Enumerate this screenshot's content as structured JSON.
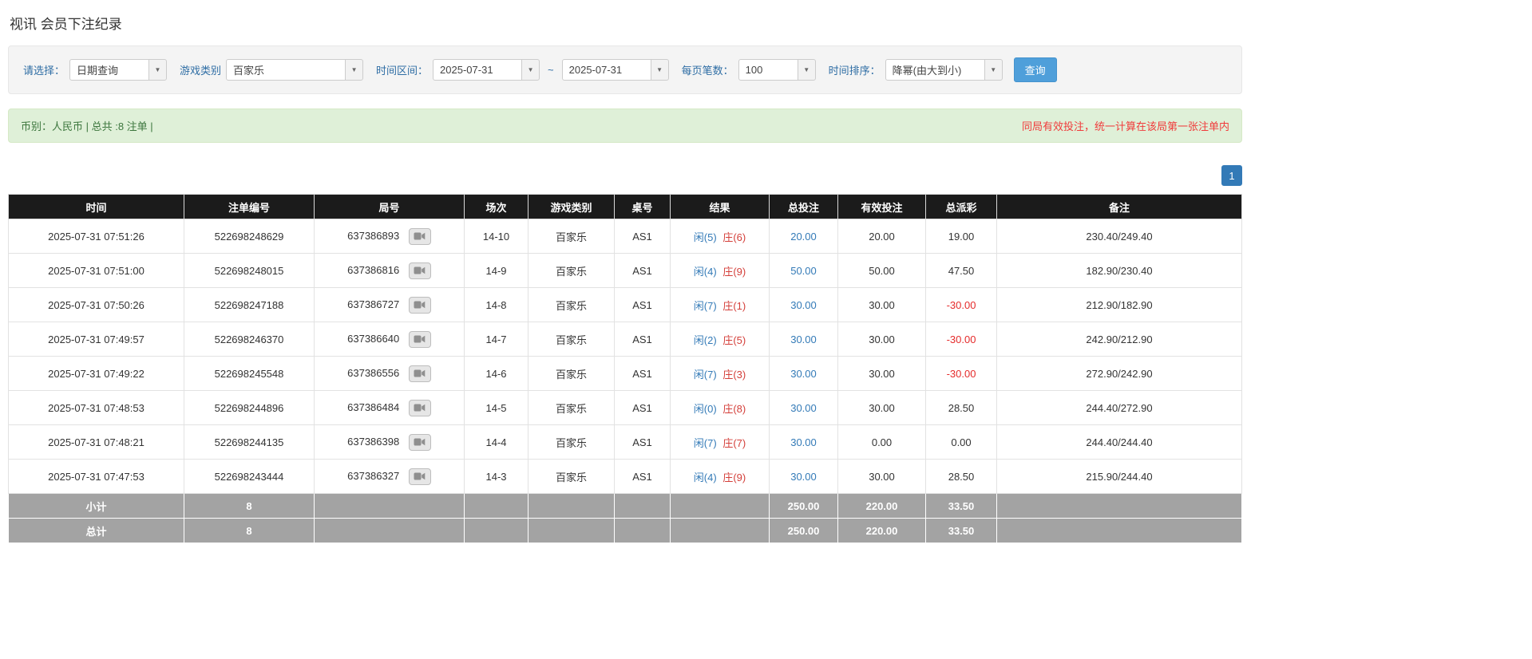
{
  "page": {
    "title": "视讯 会员下注纪录"
  },
  "filters": {
    "select_label": "请选择：",
    "select_value": "日期查询",
    "game_label": "游戏类别",
    "game_value": "百家乐",
    "range_label": "时间区间：",
    "date_from": "2025-07-31",
    "range_separator": "~",
    "date_to": "2025-07-31",
    "page_size_label": "每页笔数：",
    "page_size_value": "100",
    "sort_label": "时间排序：",
    "sort_value": "降幂(由大到小)",
    "search_button": "查询"
  },
  "summary": {
    "left": "币别：人民币 | 总共 :8 注单 |",
    "right": "同局有效投注，统一计算在该局第一张注单内"
  },
  "pagination": {
    "current": "1"
  },
  "icons": {
    "caret": "▼",
    "replay": "video-replay-icon"
  },
  "colors": {
    "header_bg": "#1b1b1b",
    "footer_bg": "#a3a3a3",
    "link_blue": "#337ab7",
    "banker_red": "#d43f3a",
    "negative_red": "#e52b2b",
    "summary_bg": "#dff0d8",
    "summary_text": "#3c763d",
    "notice_red": "#f03b3b",
    "search_button_bg": "#4f9fda",
    "pagination_bg": "#337ab7"
  },
  "table": {
    "headers": [
      "时间",
      "注单编号",
      "局号",
      "场次",
      "游戏类别",
      "桌号",
      "结果",
      "总投注",
      "有效投注",
      "总派彩",
      "备注"
    ],
    "rows": [
      {
        "time": "2025-07-31 07:51:26",
        "bet_id": "522698248629",
        "round_id": "637386893",
        "session": "14-10",
        "game_type": "百家乐",
        "table_no": "AS1",
        "result_player": "闲(5)",
        "result_banker": "庄(6)",
        "total_bet": "20.00",
        "valid_bet": "20.00",
        "payout": "19.00",
        "note": "230.40/249.40"
      },
      {
        "time": "2025-07-31 07:51:00",
        "bet_id": "522698248015",
        "round_id": "637386816",
        "session": "14-9",
        "game_type": "百家乐",
        "table_no": "AS1",
        "result_player": "闲(4)",
        "result_banker": "庄(9)",
        "total_bet": "50.00",
        "valid_bet": "50.00",
        "payout": "47.50",
        "note": "182.90/230.40"
      },
      {
        "time": "2025-07-31 07:50:26",
        "bet_id": "522698247188",
        "round_id": "637386727",
        "session": "14-8",
        "game_type": "百家乐",
        "table_no": "AS1",
        "result_player": "闲(7)",
        "result_banker": "庄(1)",
        "total_bet": "30.00",
        "valid_bet": "30.00",
        "payout": "-30.00",
        "note": "212.90/182.90"
      },
      {
        "time": "2025-07-31 07:49:57",
        "bet_id": "522698246370",
        "round_id": "637386640",
        "session": "14-7",
        "game_type": "百家乐",
        "table_no": "AS1",
        "result_player": "闲(2)",
        "result_banker": "庄(5)",
        "total_bet": "30.00",
        "valid_bet": "30.00",
        "payout": "-30.00",
        "note": "242.90/212.90"
      },
      {
        "time": "2025-07-31 07:49:22",
        "bet_id": "522698245548",
        "round_id": "637386556",
        "session": "14-6",
        "game_type": "百家乐",
        "table_no": "AS1",
        "result_player": "闲(7)",
        "result_banker": "庄(3)",
        "total_bet": "30.00",
        "valid_bet": "30.00",
        "payout": "-30.00",
        "note": "272.90/242.90"
      },
      {
        "time": "2025-07-31 07:48:53",
        "bet_id": "522698244896",
        "round_id": "637386484",
        "session": "14-5",
        "game_type": "百家乐",
        "table_no": "AS1",
        "result_player": "闲(0)",
        "result_banker": "庄(8)",
        "total_bet": "30.00",
        "valid_bet": "30.00",
        "payout": "28.50",
        "note": "244.40/272.90"
      },
      {
        "time": "2025-07-31 07:48:21",
        "bet_id": "522698244135",
        "round_id": "637386398",
        "session": "14-4",
        "game_type": "百家乐",
        "table_no": "AS1",
        "result_player": "闲(7)",
        "result_banker": "庄(7)",
        "total_bet": "30.00",
        "valid_bet": "0.00",
        "payout": "0.00",
        "note": "244.40/244.40"
      },
      {
        "time": "2025-07-31 07:47:53",
        "bet_id": "522698243444",
        "round_id": "637386327",
        "session": "14-3",
        "game_type": "百家乐",
        "table_no": "AS1",
        "result_player": "闲(4)",
        "result_banker": "庄(9)",
        "total_bet": "30.00",
        "valid_bet": "30.00",
        "payout": "28.50",
        "note": "215.90/244.40"
      }
    ],
    "subtotal": {
      "label": "小计",
      "count": "8",
      "total_bet": "250.00",
      "valid_bet": "220.00",
      "payout": "33.50"
    },
    "total": {
      "label": "总计",
      "count": "8",
      "total_bet": "250.00",
      "valid_bet": "220.00",
      "payout": "33.50"
    }
  }
}
